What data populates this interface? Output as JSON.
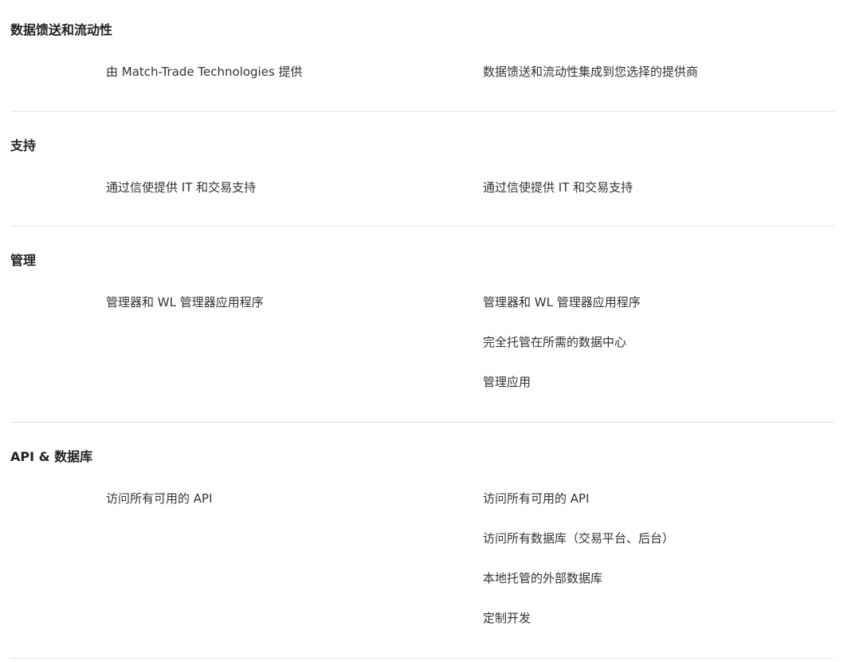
{
  "sections": [
    {
      "title": "数据馈送和流动性",
      "left": [
        "由 Match-Trade Technologies 提供"
      ],
      "right": [
        "数据馈送和流动性集成到您选择的提供商"
      ]
    },
    {
      "title": "支持",
      "left": [
        "通过信使提供 IT 和交易支持"
      ],
      "right": [
        "通过信使提供 IT 和交易支持"
      ]
    },
    {
      "title": "管理",
      "left": [
        "管理器和 WL 管理器应用程序"
      ],
      "right": [
        "管理器和 WL 管理器应用程序",
        "完全托管在所需的数据中心",
        "管理应用"
      ]
    },
    {
      "title": "API & 数据库",
      "left": [
        "访问所有可用的 API"
      ],
      "right": [
        "访问所有可用的 API",
        "访问所有数据库（交易平台、后台）",
        "本地托管的外部数据库",
        "定制开发"
      ]
    }
  ]
}
